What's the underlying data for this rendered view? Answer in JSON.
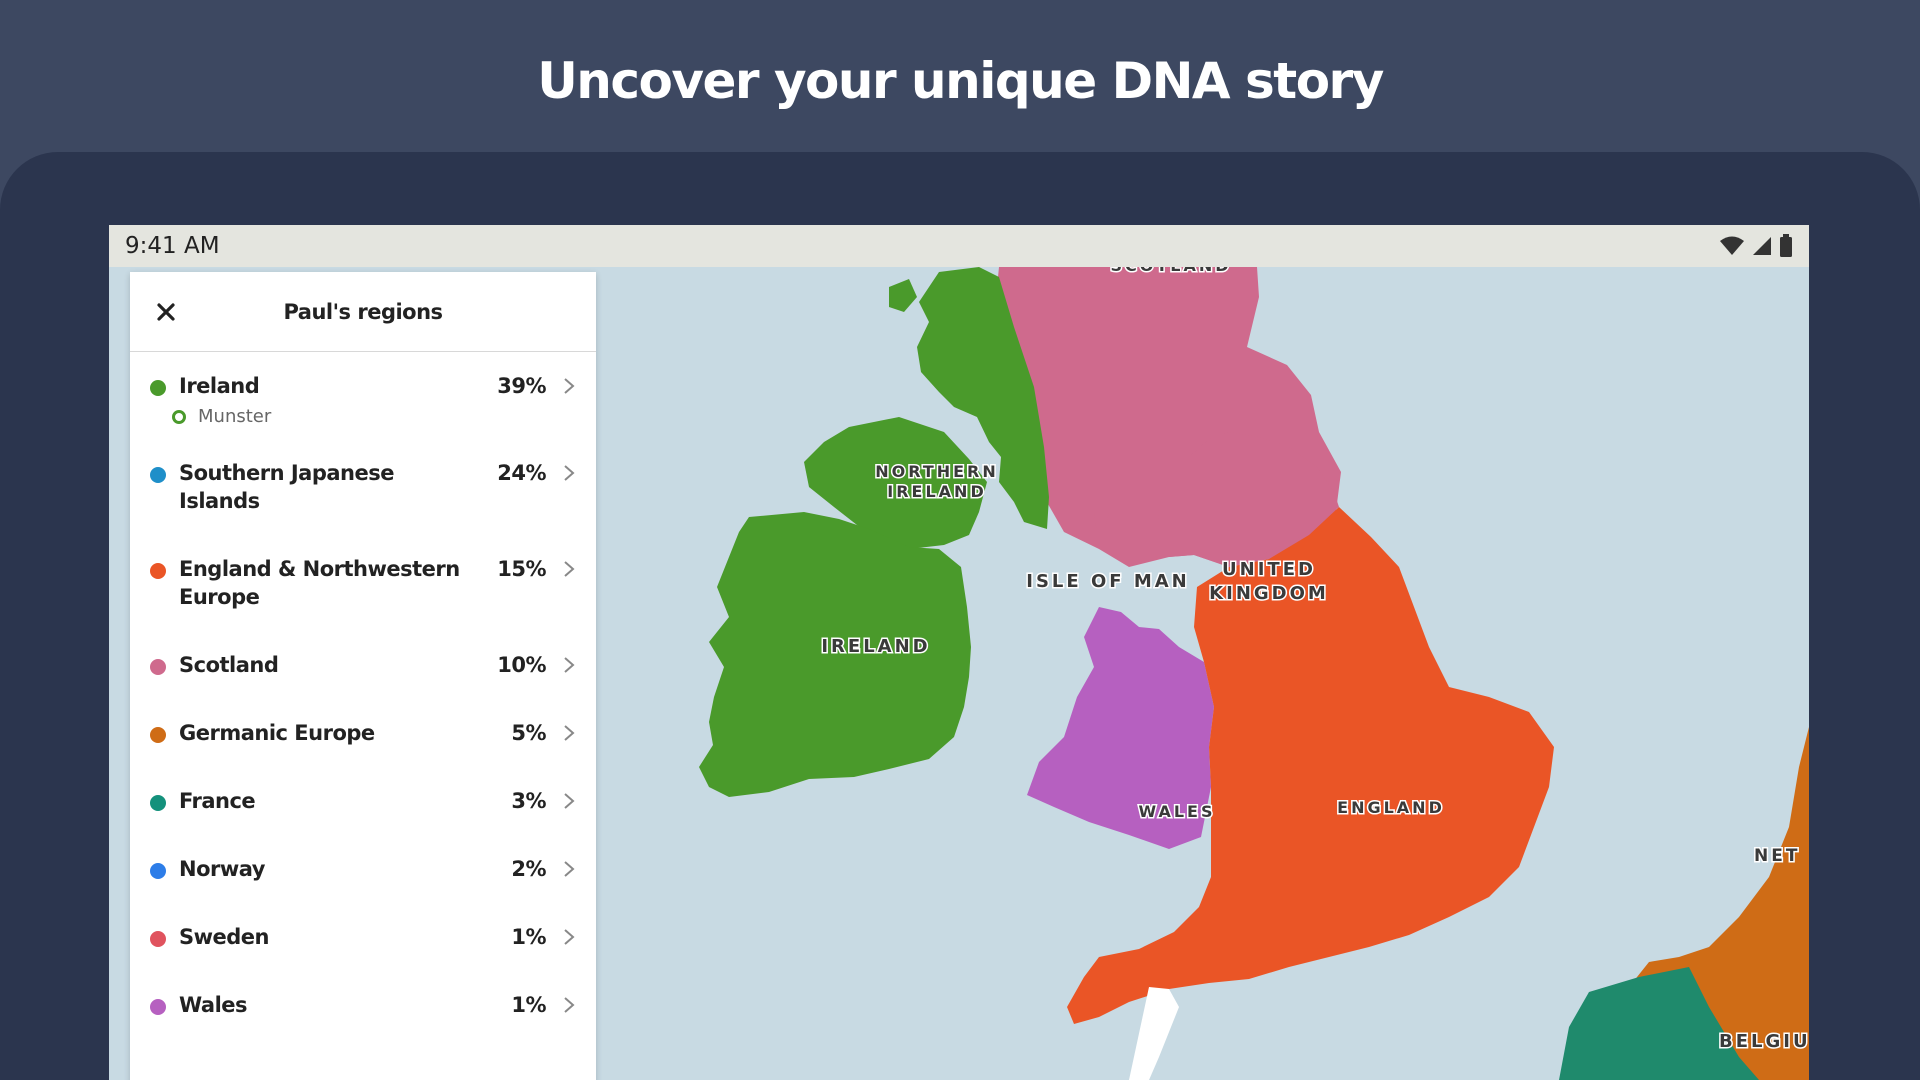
{
  "headline": "Uncover your unique DNA story",
  "status_bar": {
    "time": "9:41 AM",
    "icons": [
      "wifi-icon",
      "cell-signal-icon",
      "battery-icon"
    ]
  },
  "panel": {
    "title": "Paul's regions",
    "close_icon": "close-icon",
    "regions": [
      {
        "name": "Ireland",
        "percent": "39%",
        "color": "#4a9a2b",
        "subregion": "Munster"
      },
      {
        "name": "Southern Japanese Islands",
        "percent": "24%",
        "color": "#1f8fc9"
      },
      {
        "name": "England & Northwestern Europe",
        "percent": "15%",
        "color": "#ea5526"
      },
      {
        "name": "Scotland",
        "percent": "10%",
        "color": "#cf6a8d"
      },
      {
        "name": "Germanic Europe",
        "percent": "5%",
        "color": "#cf6c16"
      },
      {
        "name": "France",
        "percent": "3%",
        "color": "#14917c"
      },
      {
        "name": "Norway",
        "percent": "2%",
        "color": "#2d7de8"
      },
      {
        "name": "Sweden",
        "percent": "1%",
        "color": "#e0535e"
      },
      {
        "name": "Wales",
        "percent": "1%",
        "color": "#b660c0"
      }
    ]
  },
  "map": {
    "labels": {
      "scotland_partial": "SCOTLAND",
      "northern_ireland_1": "NORTHERN",
      "northern_ireland_2": "IRELAND",
      "ireland": "IRELAND",
      "isle_of_man": "ISLE OF MAN",
      "united_kingdom_1": "UNITED",
      "united_kingdom_2": "KINGDOM",
      "wales": "WALES",
      "england": "ENGLAND",
      "netherlands_partial": "NET",
      "belgium_partial": "BELGIU"
    },
    "colors": {
      "sea": "#c8dae3",
      "ireland": "#4a9a2b",
      "scotland": "#cf6a8d",
      "england": "#ea5526",
      "wales": "#b660c0",
      "germanic": "#cf6c16",
      "france": "#1f8a6c",
      "land_white": "#ffffff"
    }
  }
}
